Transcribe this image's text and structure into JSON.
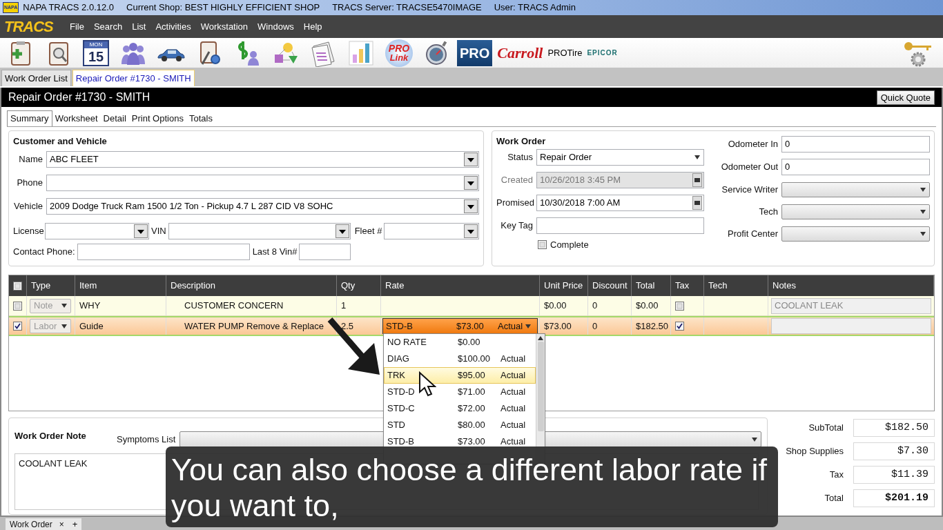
{
  "title_bar": {
    "logo": "NAPA",
    "app": "NAPA TRACS 2.0.12.0",
    "shop": "Current Shop: BEST HIGHLY EFFICIENT SHOP",
    "server": "TRACS Server: TRACSE5470IMAGE",
    "user": "User: TRACS Admin"
  },
  "menu": {
    "logo": "TRACS",
    "items": [
      "File",
      "Search",
      "List",
      "Activities",
      "Workstation",
      "Windows",
      "Help"
    ]
  },
  "toolbar": {
    "calendar": {
      "weekday": "MON",
      "day": "15"
    },
    "prolink": {
      "top": "PRO",
      "bottom": "Link"
    },
    "logos": [
      {
        "kind": "badge",
        "text": "PRO"
      },
      {
        "kind": "script",
        "text": "Carroll"
      },
      {
        "kind": "plain",
        "text": "PROTire"
      },
      {
        "kind": "wordmark",
        "text": "EPICOR"
      }
    ]
  },
  "doc_tabs": [
    {
      "label": "Work Order List",
      "selected": false
    },
    {
      "label": "Repair Order #1730 - SMITH",
      "selected": true
    }
  ],
  "header": {
    "title": "Repair Order #1730 - SMITH",
    "button": "Quick Quote"
  },
  "tabs": [
    {
      "label": "Summary",
      "selected": true
    },
    {
      "label": "Worksheet",
      "selected": false
    },
    {
      "label": "Detail",
      "selected": false
    },
    {
      "label": "Print Options",
      "selected": false
    },
    {
      "label": "Totals",
      "selected": false
    }
  ],
  "customer": {
    "heading": "Customer and Vehicle",
    "name": {
      "label": "Name",
      "value": "ABC FLEET"
    },
    "phone": {
      "label": "Phone"
    },
    "vehicle": {
      "label": "Vehicle",
      "value": "2009 Dodge Truck Ram 1500 1/2 Ton - Pickup 4.7 L 287 CID V8 SOHC"
    },
    "license": {
      "label": "License"
    },
    "vin": {
      "label": "VIN"
    },
    "fleet": {
      "label": "Fleet #"
    },
    "contact_phone": {
      "label": "Contact Phone:"
    },
    "last8_vin": {
      "label": "Last 8 Vin#"
    }
  },
  "work_order": {
    "heading": "Work Order",
    "status": {
      "label": "Status",
      "value": "Repair Order"
    },
    "created": {
      "label": "Created",
      "value": "10/26/2018 3:45 PM",
      "disabled": true
    },
    "promised": {
      "label": "Promised",
      "value": "10/30/2018 7:00 AM",
      "disabled": false
    },
    "key_tag": {
      "label": "Key Tag"
    },
    "complete": {
      "label": "Complete",
      "checked": false
    },
    "odometer_in": {
      "label": "Odometer In",
      "value": "0"
    },
    "odometer_out": {
      "label": "Odometer Out",
      "value": "0"
    },
    "service_writer": {
      "label": "Service Writer"
    },
    "tech": {
      "label": "Tech"
    },
    "profit_center": {
      "label": "Profit Center"
    }
  },
  "grid": {
    "select_all": false,
    "columns": [
      "Type",
      "Item",
      "Description",
      "Qty",
      "Rate",
      "Unit Price",
      "Discount",
      "Total",
      "Tax",
      "Tech",
      "Notes"
    ],
    "rows": [
      {
        "checked": false,
        "selected": false,
        "type": "Note",
        "item": "WHY",
        "description": "CUSTOMER CONCERN",
        "qty": "1",
        "unit_price": "$0.00",
        "discount": "0",
        "total": "$0.00",
        "tax": false,
        "notes": "COOLANT LEAK"
      },
      {
        "checked": true,
        "selected": true,
        "type": "Labor",
        "item": "Guide",
        "description": "WATER PUMP Remove & Replace",
        "qty": "2.5",
        "rate": {
          "name": "STD-B",
          "price": "$73.00",
          "basis": "Actual"
        },
        "unit_price": "$73.00",
        "discount": "0",
        "total": "$182.50",
        "tax": true
      }
    ]
  },
  "rate_dropdown": {
    "options": [
      {
        "name": "NO RATE",
        "price": "$0.00",
        "selected": false
      },
      {
        "name": "DIAG",
        "price": "$100.00",
        "basis": "Actual",
        "selected": false
      },
      {
        "name": "TRK",
        "price": "$95.00",
        "basis": "Actual",
        "selected": true
      },
      {
        "name": "STD-D",
        "price": "$71.00",
        "basis": "Actual",
        "selected": false
      },
      {
        "name": "STD-C",
        "price": "$72.00",
        "basis": "Actual",
        "selected": false
      },
      {
        "name": "STD",
        "price": "$80.00",
        "basis": "Actual",
        "selected": false
      },
      {
        "name": "STD-B",
        "price": "$73.00",
        "basis": "Actual",
        "selected": false
      }
    ]
  },
  "note": {
    "heading": "Work Order Note",
    "symptoms_label": "Symptoms List",
    "text": "COOLANT LEAK"
  },
  "totals": [
    {
      "label": "SubTotal",
      "value": "$182.50",
      "bold": false
    },
    {
      "label": "Shop Supplies",
      "value": "$7.30",
      "bold": false
    },
    {
      "label": "Tax",
      "value": "$11.39",
      "bold": false
    },
    {
      "label": "Total",
      "value": "$201.19",
      "bold": true
    }
  ],
  "bottom_tabs": [
    {
      "label": "Work Order",
      "close": "×"
    }
  ],
  "bottom_add": "+",
  "caption": "You can also choose a different labor rate if you want to,"
}
